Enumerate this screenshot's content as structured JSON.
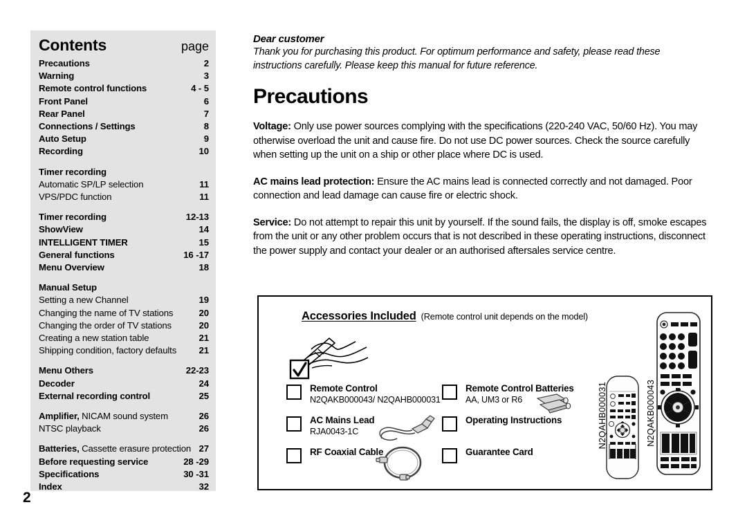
{
  "page_number": "2",
  "contents": {
    "title": "Contents",
    "page_column_label": "page",
    "rows": [
      {
        "label": "Precautions",
        "page": "2",
        "style": "bold"
      },
      {
        "label": "Warning",
        "page": "3",
        "style": "bold"
      },
      {
        "label": "Remote control functions",
        "page": "4 - 5",
        "style": "bold"
      },
      {
        "label": "Front Panel",
        "page": "6",
        "style": "bold"
      },
      {
        "label": "Rear Panel",
        "page": "7",
        "style": "bold"
      },
      {
        "label": "Connections / Settings",
        "page": "8",
        "style": "bold"
      },
      {
        "label": "Auto Setup",
        "page": "9",
        "style": "bold"
      },
      {
        "label": "Recording",
        "page": "10",
        "style": "bold"
      },
      {
        "gap": true
      },
      {
        "label": "Timer recording",
        "page": "",
        "style": "bold"
      },
      {
        "label": "Automatic SP/LP selection",
        "page": "11",
        "style": "plain"
      },
      {
        "label": "VPS/PDC function",
        "page": "11",
        "style": "plain"
      },
      {
        "gap": true
      },
      {
        "label": "Timer recording",
        "page": "12-13",
        "style": "bold"
      },
      {
        "label": "ShowView",
        "page": "14",
        "style": "bold"
      },
      {
        "label": "INTELLIGENT TIMER",
        "page": "15",
        "style": "bold"
      },
      {
        "label": "General functions",
        "page": "16 -17",
        "style": "bold"
      },
      {
        "label": "Menu Overview",
        "page": "18",
        "style": "bold"
      },
      {
        "gap": true
      },
      {
        "label": "Manual Setup",
        "page": "",
        "style": "bold"
      },
      {
        "label": "Setting a new Channel",
        "page": "19",
        "style": "plain"
      },
      {
        "label": "Changing the name of TV stations",
        "page": "20",
        "style": "plain"
      },
      {
        "label": "Changing the order of TV stations",
        "page": "20",
        "style": "plain"
      },
      {
        "label": "Creating a new station table",
        "page": "21",
        "style": "plain"
      },
      {
        "label": "Shipping condition, factory defaults",
        "page": "21",
        "style": "plain"
      },
      {
        "gap": true
      },
      {
        "label": "Menu Others",
        "page": "22-23",
        "style": "bold"
      },
      {
        "label": "Decoder",
        "page": "24",
        "style": "bold"
      },
      {
        "label": "External recording control",
        "page": "25",
        "style": "bold"
      },
      {
        "gap": true
      },
      {
        "label_bold": "Amplifier,",
        "label_rest": " NICAM sound system",
        "page": "26",
        "style": "mixed"
      },
      {
        "label": "NTSC playback",
        "page": "26",
        "style": "plain"
      },
      {
        "gap": true
      },
      {
        "label_bold": "Batteries,",
        "label_rest": " Cassette erasure protection",
        "page": "27",
        "style": "mixed"
      },
      {
        "label": "Before requesting service",
        "page": "28 -29",
        "style": "bold"
      },
      {
        "label": "Specifications",
        "page": "30 -31",
        "style": "bold"
      },
      {
        "label": "Index",
        "page": "32",
        "style": "bold"
      }
    ]
  },
  "dear_customer": {
    "title": "Dear customer",
    "body": "Thank you for purchasing this product. For optimum performance and safety, please read these instructions carefully. Please keep this manual for future reference."
  },
  "precautions": {
    "heading": "Precautions",
    "paragraphs": [
      {
        "lead": "Voltage:",
        "text": " Only use power sources complying with the specifications (220-240 VAC, 50/60 Hz). You may otherwise overload the unit and cause fire. Do not use DC power sources. Check the source carefully when setting up the unit on a ship or other place where DC is used."
      },
      {
        "lead": "AC mains lead protection:",
        "text": " Ensure the AC mains lead is connected correctly and not damaged. Poor connection and lead damage can cause fire or electric shock."
      },
      {
        "lead": "Service:",
        "text": " Do not attempt to repair this unit by yourself. If the sound fails, the display is off, smoke escapes from the unit or any other problem occurs that is not described in these operating instructions, disconnect the power supply and contact your dealer or an authorised aftersales service centre."
      }
    ]
  },
  "accessories": {
    "title": "Accessories Included",
    "subtitle": "(Remote control unit depends on the model)",
    "left_items": [
      {
        "name": "Remote Control",
        "sub": "N2QAKB000043/ N2QAHB000031",
        "art": "none"
      },
      {
        "name": "AC Mains Lead",
        "sub": "RJA0043-1C",
        "art": "mains-lead"
      },
      {
        "name": "RF Coaxial Cable",
        "sub": "",
        "art": "coax-cable"
      }
    ],
    "right_items": [
      {
        "name": "Remote Control Batteries",
        "sub": "AA, UM3 or R6",
        "art": "batteries"
      },
      {
        "name": "Operating Instructions",
        "sub": "",
        "art": "none"
      },
      {
        "name": "Guarantee Card",
        "sub": "",
        "art": "none"
      }
    ],
    "remote_labels": {
      "remote_a": "N2QAHB000031",
      "remote_b": "N2QAKB000043"
    }
  },
  "colors": {
    "sidebar_bg": "#e3e3e3",
    "text": "#000000",
    "box_border": "#000000",
    "art_gray": "#9a9a9a"
  }
}
